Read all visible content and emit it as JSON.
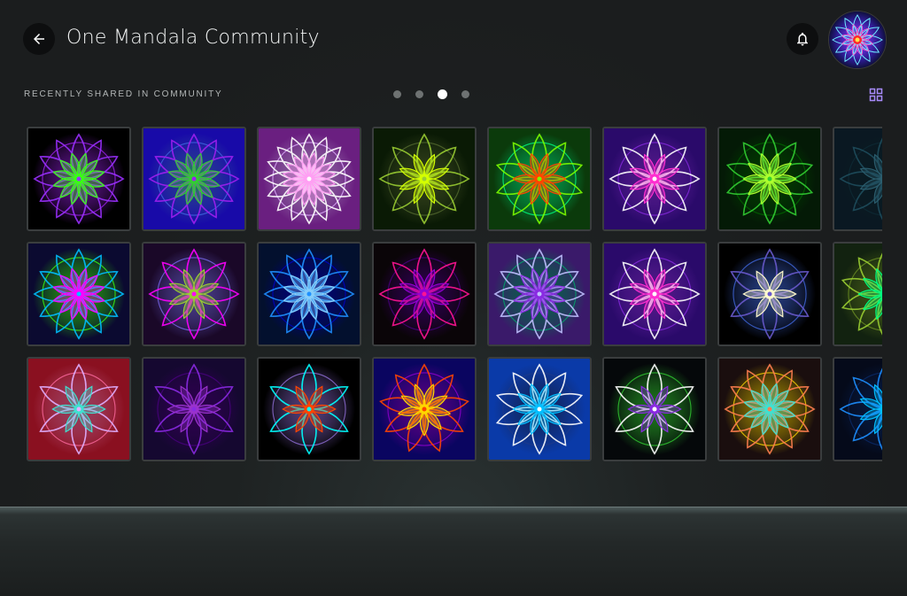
{
  "header": {
    "title": "One Mandala Community",
    "back_icon": "arrow-left-icon",
    "bell_icon": "bell-icon"
  },
  "section": {
    "label": "RECENTLY SHARED IN COMMUNITY",
    "page_count": 4,
    "active_page": 3,
    "grid_icon": "grid-view-icon"
  },
  "colors": {
    "background": "#1b1d1e",
    "accent": "#a78bfa",
    "tile_border": "#3a3d3e"
  },
  "tiles": [
    {
      "bg": "#000000",
      "c1": "#9b30ff",
      "c2": "#39ff14",
      "c3": "#a020f0",
      "petals": 12
    },
    {
      "bg": "#180aa8",
      "c1": "#a020f0",
      "c2": "#32cd32",
      "c3": "#4169e1",
      "petals": 12
    },
    {
      "bg": "#6a1f80",
      "c1": "#ffffff",
      "c2": "#ff9ff3",
      "c3": "#e0b0ff",
      "petals": 16
    },
    {
      "bg": "#0a1a05",
      "c1": "#9acd32",
      "c2": "#d4ff00",
      "c3": "#556b2f",
      "petals": 8
    },
    {
      "bg": "#0b3a0b",
      "c1": "#7cfc00",
      "c2": "#ff4500",
      "c3": "#00ff7f",
      "petals": 10
    },
    {
      "bg": "#2a0a6a",
      "c1": "#ffffff",
      "c2": "#ff2fd0",
      "c3": "#8a2be2",
      "petals": 8
    },
    {
      "bg": "#041a06",
      "c1": "#32cd32",
      "c2": "#adff2f",
      "c3": "#006400",
      "petals": 10
    },
    {
      "bg": "#0a1822",
      "c1": "#1e4d5c",
      "c2": "#2b5d6d",
      "c3": "#0e2a35",
      "petals": 8
    },
    {
      "bg": "#0b0a30",
      "c1": "#00bfff",
      "c2": "#ff00ff",
      "c3": "#39ff14",
      "petals": 12
    },
    {
      "bg": "#1a0828",
      "c1": "#ff00ff",
      "c2": "#9acd32",
      "c3": "#7b68ee",
      "petals": 8
    },
    {
      "bg": "#03102e",
      "c1": "#1e90ff",
      "c2": "#87cefa",
      "c3": "#0000cd",
      "petals": 12
    },
    {
      "bg": "#0a0508",
      "c1": "#ff1493",
      "c2": "#9400d3",
      "c3": "#4b0082",
      "petals": 8
    },
    {
      "bg": "#3a1a6a",
      "c1": "#c0c0ff",
      "c2": "#8a2be2",
      "c3": "#00a86b",
      "petals": 12
    },
    {
      "bg": "#2a0a6a",
      "c1": "#ffffff",
      "c2": "#ff2fd0",
      "c3": "#8a2be2",
      "petals": 8
    },
    {
      "bg": "#000000",
      "c1": "#6a5acd",
      "c2": "#fffacd",
      "c3": "#4169e1",
      "petals": 6
    },
    {
      "bg": "#122210",
      "c1": "#9acd32",
      "c2": "#00ff7f",
      "c3": "#6b8e23",
      "petals": 10
    },
    {
      "bg": "#8a1020",
      "c1": "#e0b0ff",
      "c2": "#40e0d0",
      "c3": "#ff6aa0",
      "petals": 6
    },
    {
      "bg": "#150830",
      "c1": "#8a2be2",
      "c2": "#9932cc",
      "c3": "#4b0082",
      "petals": 6
    },
    {
      "bg": "#000000",
      "c1": "#00ffff",
      "c2": "#ff4500",
      "c3": "#9370db",
      "petals": 6
    },
    {
      "bg": "#0a0560",
      "c1": "#ff4500",
      "c2": "#ffd700",
      "c3": "#9400d3",
      "petals": 9
    },
    {
      "bg": "#0a3aa8",
      "c1": "#ffffff",
      "c2": "#00bfff",
      "c3": "#1e3a8a",
      "petals": 10
    },
    {
      "bg": "#05080a",
      "c1": "#ffffff",
      "c2": "#8a2be2",
      "c3": "#32cd32",
      "petals": 6
    },
    {
      "bg": "#1a0e0e",
      "c1": "#ff7f50",
      "c2": "#40e0d0",
      "c3": "#ffd700",
      "petals": 12
    },
    {
      "bg": "#050a1a",
      "c1": "#1e90ff",
      "c2": "#00bfff",
      "c3": "#0a2a6a",
      "petals": 8
    }
  ]
}
